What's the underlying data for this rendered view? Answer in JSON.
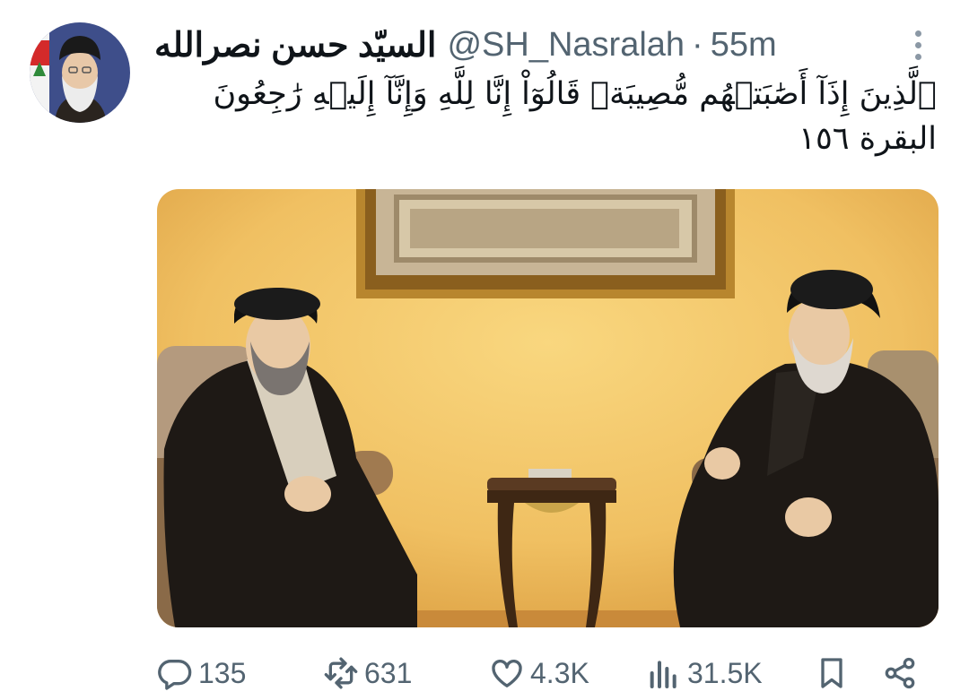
{
  "author": {
    "name": "السيّد حسن نصرالله",
    "handle": "@SH_Nasralah",
    "separator": "·",
    "time": "55m"
  },
  "tweet": {
    "lines": [
      "ٱلَّذِينَ إِذَآ أَصَٰبَتۡهُم مُّصِيبَةٞ قَالُوٓاْ إِنَّا لِلَّهِ وَإِنَّآ إِلَيۡهِ رَٰجِعُونَ",
      "البقرة ١٥٦"
    ]
  },
  "actions": {
    "reply": {
      "icon": "reply-icon",
      "count": "135"
    },
    "retweet": {
      "icon": "retweet-icon",
      "count": "631"
    },
    "like": {
      "icon": "heart-icon",
      "count": "4.3K"
    },
    "views": {
      "icon": "views-icon",
      "count": "31.5K"
    },
    "bookmark": {
      "icon": "bookmark-icon"
    },
    "share": {
      "icon": "share-icon"
    }
  },
  "colors": {
    "text": "#0f1419",
    "secondary": "#536471",
    "icon": "#536471",
    "more_dots": "#8b98a5",
    "wall": "#f2c566",
    "robe": "#1e1915",
    "frame_gold": "#b8862e"
  }
}
